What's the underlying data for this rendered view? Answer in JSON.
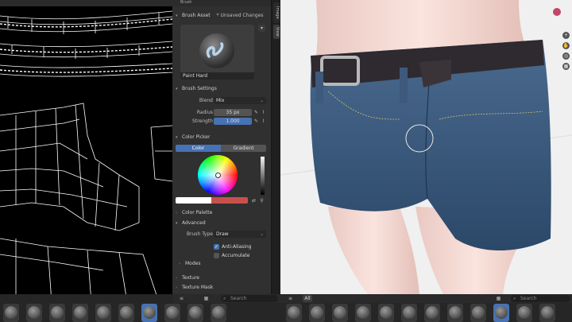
{
  "panel": {
    "top_label": "Brush",
    "brush_asset": {
      "title": "Brush Asset",
      "status": "* Unsaved Changes",
      "preview_name": "Paint Hard"
    },
    "brush_settings": {
      "title": "Brush Settings",
      "blend": {
        "label": "Blend",
        "value": "Mix"
      },
      "radius": {
        "label": "Radius",
        "value": "35 px"
      },
      "strength": {
        "label": "Strength",
        "value": "1.000"
      }
    },
    "color_picker": {
      "title": "Color Picker",
      "tab_color": "Color",
      "tab_gradient": "Gradient"
    },
    "color_palette": {
      "title": "Color Palette"
    },
    "advanced": {
      "title": "Advanced",
      "brush_type": {
        "label": "Brush Type",
        "value": "Draw"
      },
      "anti_aliasing": "Anti-Aliasing",
      "accumulate": "Accumulate",
      "modes": "Modes"
    },
    "texture": {
      "title": "Texture"
    },
    "texture_mask": {
      "title": "Texture Mask"
    }
  },
  "side_tabs": {
    "image": "Image",
    "view": "View"
  },
  "asset_shelf": {
    "left_search_placeholder": "Search",
    "right_search_placeholder": "Search",
    "all_tab": "All"
  },
  "colors": {
    "accent": "#4772b3",
    "primary_color": "#ffffff",
    "secondary_color": "#c8504c",
    "strength_fill": "#4772b3"
  }
}
